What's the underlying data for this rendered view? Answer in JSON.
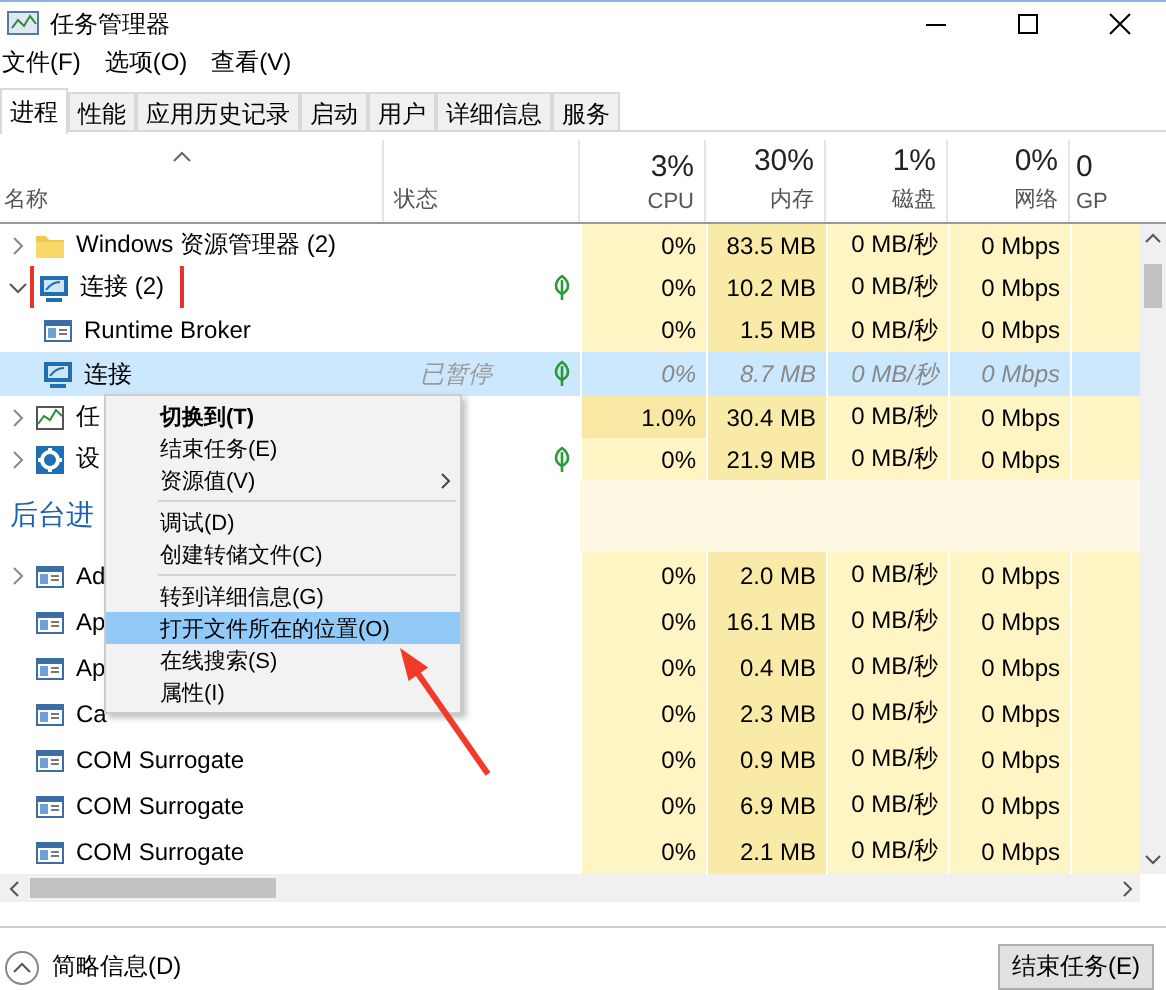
{
  "window": {
    "title": "任务管理器"
  },
  "menu": [
    "文件(F)",
    "选项(O)",
    "查看(V)"
  ],
  "tabs": [
    {
      "label": "进程",
      "selected": true
    },
    {
      "label": "性能",
      "selected": false
    },
    {
      "label": "应用历史记录",
      "selected": false
    },
    {
      "label": "启动",
      "selected": false
    },
    {
      "label": "用户",
      "selected": false
    },
    {
      "label": "详细信息",
      "selected": false
    },
    {
      "label": "服务",
      "selected": false
    }
  ],
  "columns": {
    "name": "名称",
    "status": "状态",
    "metrics": [
      {
        "percent": "3%",
        "label": "CPU"
      },
      {
        "percent": "30%",
        "label": "内存"
      },
      {
        "percent": "1%",
        "label": "磁盘"
      },
      {
        "percent": "0%",
        "label": "网络"
      },
      {
        "percent": "0",
        "label": "GP"
      }
    ]
  },
  "groups": [
    {
      "rows": [
        {
          "name": "Windows 资源管理器 (2)",
          "kind": "folder",
          "expanded": false,
          "highlighted": false,
          "efficiency": false,
          "selected": false,
          "values": [
            "0%",
            "83.5 MB",
            "0 MB/秒",
            "0 Mbps"
          ]
        },
        {
          "name": "连接 (2)",
          "kind": "remote",
          "expanded": true,
          "highlighted": true,
          "efficiency": true,
          "selected": false,
          "values": [
            "0%",
            "10.2 MB",
            "0 MB/秒",
            "0 Mbps"
          ],
          "children": [
            {
              "name": "Runtime Broker",
              "kind": "window",
              "highlighted": false,
              "efficiency": false,
              "selected": false,
              "values": [
                "0%",
                "1.5 MB",
                "0 MB/秒",
                "0 Mbps"
              ]
            },
            {
              "name": "连接",
              "kind": "remote",
              "status": "已暂停",
              "highlighted": false,
              "efficiency": true,
              "selected": true,
              "values": [
                "0%",
                "8.7 MB",
                "0 MB/秒",
                "0 Mbps"
              ]
            }
          ]
        },
        {
          "name": "任",
          "kind": "chart",
          "expanded": false,
          "highlighted": false,
          "efficiency": false,
          "selected": false,
          "values": [
            "1.0%",
            "30.4 MB",
            "0 MB/秒",
            "0 Mbps"
          ]
        },
        {
          "name": "设",
          "kind": "gear",
          "expanded": false,
          "highlighted": false,
          "efficiency": true,
          "selected": false,
          "values": [
            "0%",
            "21.9 MB",
            "0 MB/秒",
            "0 Mbps"
          ]
        }
      ]
    },
    {
      "heading": "后台进",
      "rows": [
        {
          "name": "Ad",
          "kind": "window",
          "expanded": false,
          "highlighted": false,
          "efficiency": false,
          "selected": false,
          "values": [
            "0%",
            "2.0 MB",
            "0 MB/秒",
            "0 Mbps"
          ]
        },
        {
          "name": "Ap",
          "kind": "window",
          "highlighted": false,
          "efficiency": false,
          "selected": false,
          "values": [
            "0%",
            "16.1 MB",
            "0 MB/秒",
            "0 Mbps"
          ]
        },
        {
          "name": "Ap",
          "kind": "window",
          "highlighted": false,
          "efficiency": false,
          "selected": false,
          "values": [
            "0%",
            "0.4 MB",
            "0 MB/秒",
            "0 Mbps"
          ]
        },
        {
          "name": "Ca",
          "kind": "window",
          "highlighted": false,
          "efficiency": false,
          "selected": false,
          "values": [
            "0%",
            "2.3 MB",
            "0 MB/秒",
            "0 Mbps"
          ]
        },
        {
          "name": "COM Surrogate",
          "kind": "window",
          "highlighted": false,
          "efficiency": false,
          "selected": false,
          "values": [
            "0%",
            "0.9 MB",
            "0 MB/秒",
            "0 Mbps"
          ]
        },
        {
          "name": "COM Surrogate",
          "kind": "window",
          "highlighted": false,
          "efficiency": false,
          "selected": false,
          "values": [
            "0%",
            "6.9 MB",
            "0 MB/秒",
            "0 Mbps"
          ]
        },
        {
          "name": "COM Surrogate",
          "kind": "window",
          "highlighted": false,
          "efficiency": false,
          "selected": false,
          "values": [
            "0%",
            "2.1 MB",
            "0 MB/秒",
            "0 Mbps"
          ]
        }
      ]
    }
  ],
  "context_menu": {
    "sections": [
      [
        {
          "label": "切换到(T)",
          "default": true,
          "submenu": false,
          "selected": false
        },
        {
          "label": "结束任务(E)",
          "default": false,
          "submenu": false,
          "selected": false
        },
        {
          "label": "资源值(V)",
          "default": false,
          "submenu": true,
          "selected": false
        }
      ],
      [
        {
          "label": "调试(D)",
          "default": false,
          "submenu": false,
          "selected": false
        },
        {
          "label": "创建转储文件(C)",
          "default": false,
          "submenu": false,
          "selected": false
        }
      ],
      [
        {
          "label": "转到详细信息(G)",
          "default": false,
          "submenu": false,
          "selected": false
        },
        {
          "label": "打开文件所在的位置(O)",
          "default": false,
          "submenu": false,
          "selected": true
        },
        {
          "label": "在线搜索(S)",
          "default": false,
          "submenu": false,
          "selected": false
        },
        {
          "label": "属性(I)",
          "default": false,
          "submenu": false,
          "selected": false
        }
      ]
    ]
  },
  "callout": {
    "kind": "arrow"
  },
  "footer": {
    "details": "简略信息(D)",
    "button": "结束任务(E)"
  }
}
